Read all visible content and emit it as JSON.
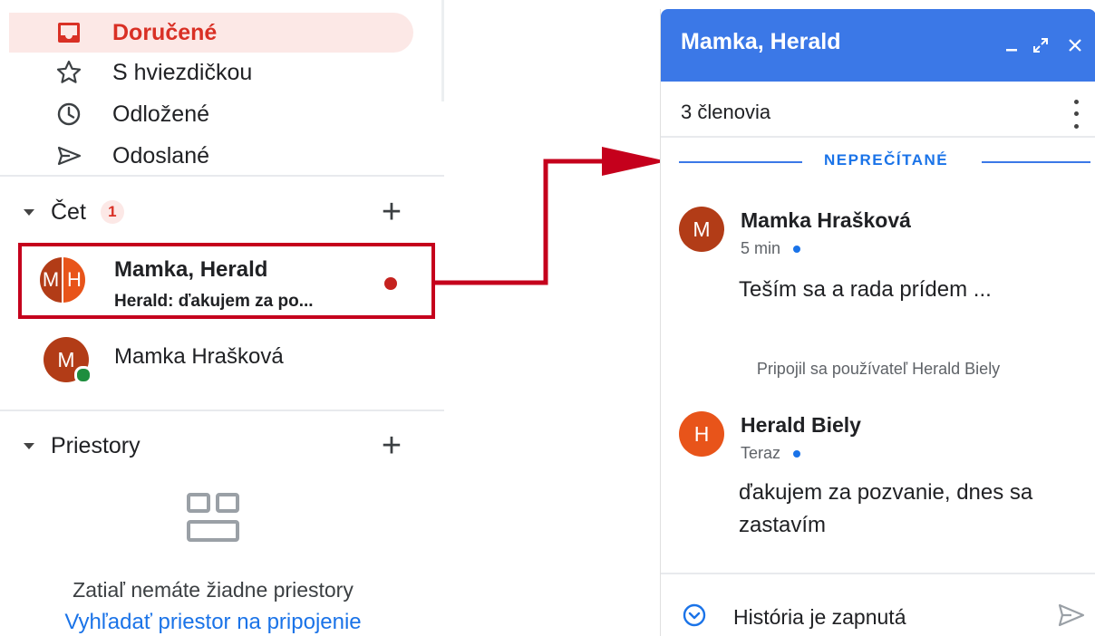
{
  "sidebar": {
    "items": [
      {
        "label": "Doručené",
        "icon": "inbox-icon",
        "active": true
      },
      {
        "label": "S hviezdičkou",
        "icon": "star-icon"
      },
      {
        "label": "Odložené",
        "icon": "clock-icon"
      },
      {
        "label": "Odoslané",
        "icon": "send-icon"
      }
    ]
  },
  "chat_section": {
    "title": "Čet",
    "badge": "1",
    "items": [
      {
        "name": "Mamka, Herald",
        "snippet": "Herald: ďakujem za po...",
        "avatar_letters": [
          "M",
          "H"
        ],
        "unread": true
      },
      {
        "name": "Mamka Hrašková",
        "avatar_letter": "M",
        "online": true
      }
    ]
  },
  "spaces_section": {
    "title": "Priestory",
    "empty_text": "Zatiaľ nemáte žiadne priestory",
    "find_link": "Vyhľadať priestor na pripojenie"
  },
  "chat_window": {
    "title": "Mamka, Herald",
    "members": "3 členovia",
    "unread_divider": "NEPREČÍTANÉ",
    "messages": [
      {
        "sender": "Mamka Hrašková",
        "avatar_letter": "M",
        "time": "5 min",
        "text": "Teším sa a rada prídem ..."
      },
      {
        "sender": "Herald Biely",
        "avatar_letter": "H",
        "time": "Teraz",
        "text": "ďakujem za pozvanie, dnes sa zastavím"
      }
    ],
    "system_message": "Pripojil sa používateľ Herald Biely",
    "history_status": "História je zapnutá"
  },
  "colors": {
    "header_blue": "#3b78e7",
    "accent_red": "#d93025",
    "avatar_mamka": "#b23c17",
    "avatar_herald": "#e8541a",
    "highlight_border": "#c5001c",
    "link_blue": "#1a73e8"
  }
}
